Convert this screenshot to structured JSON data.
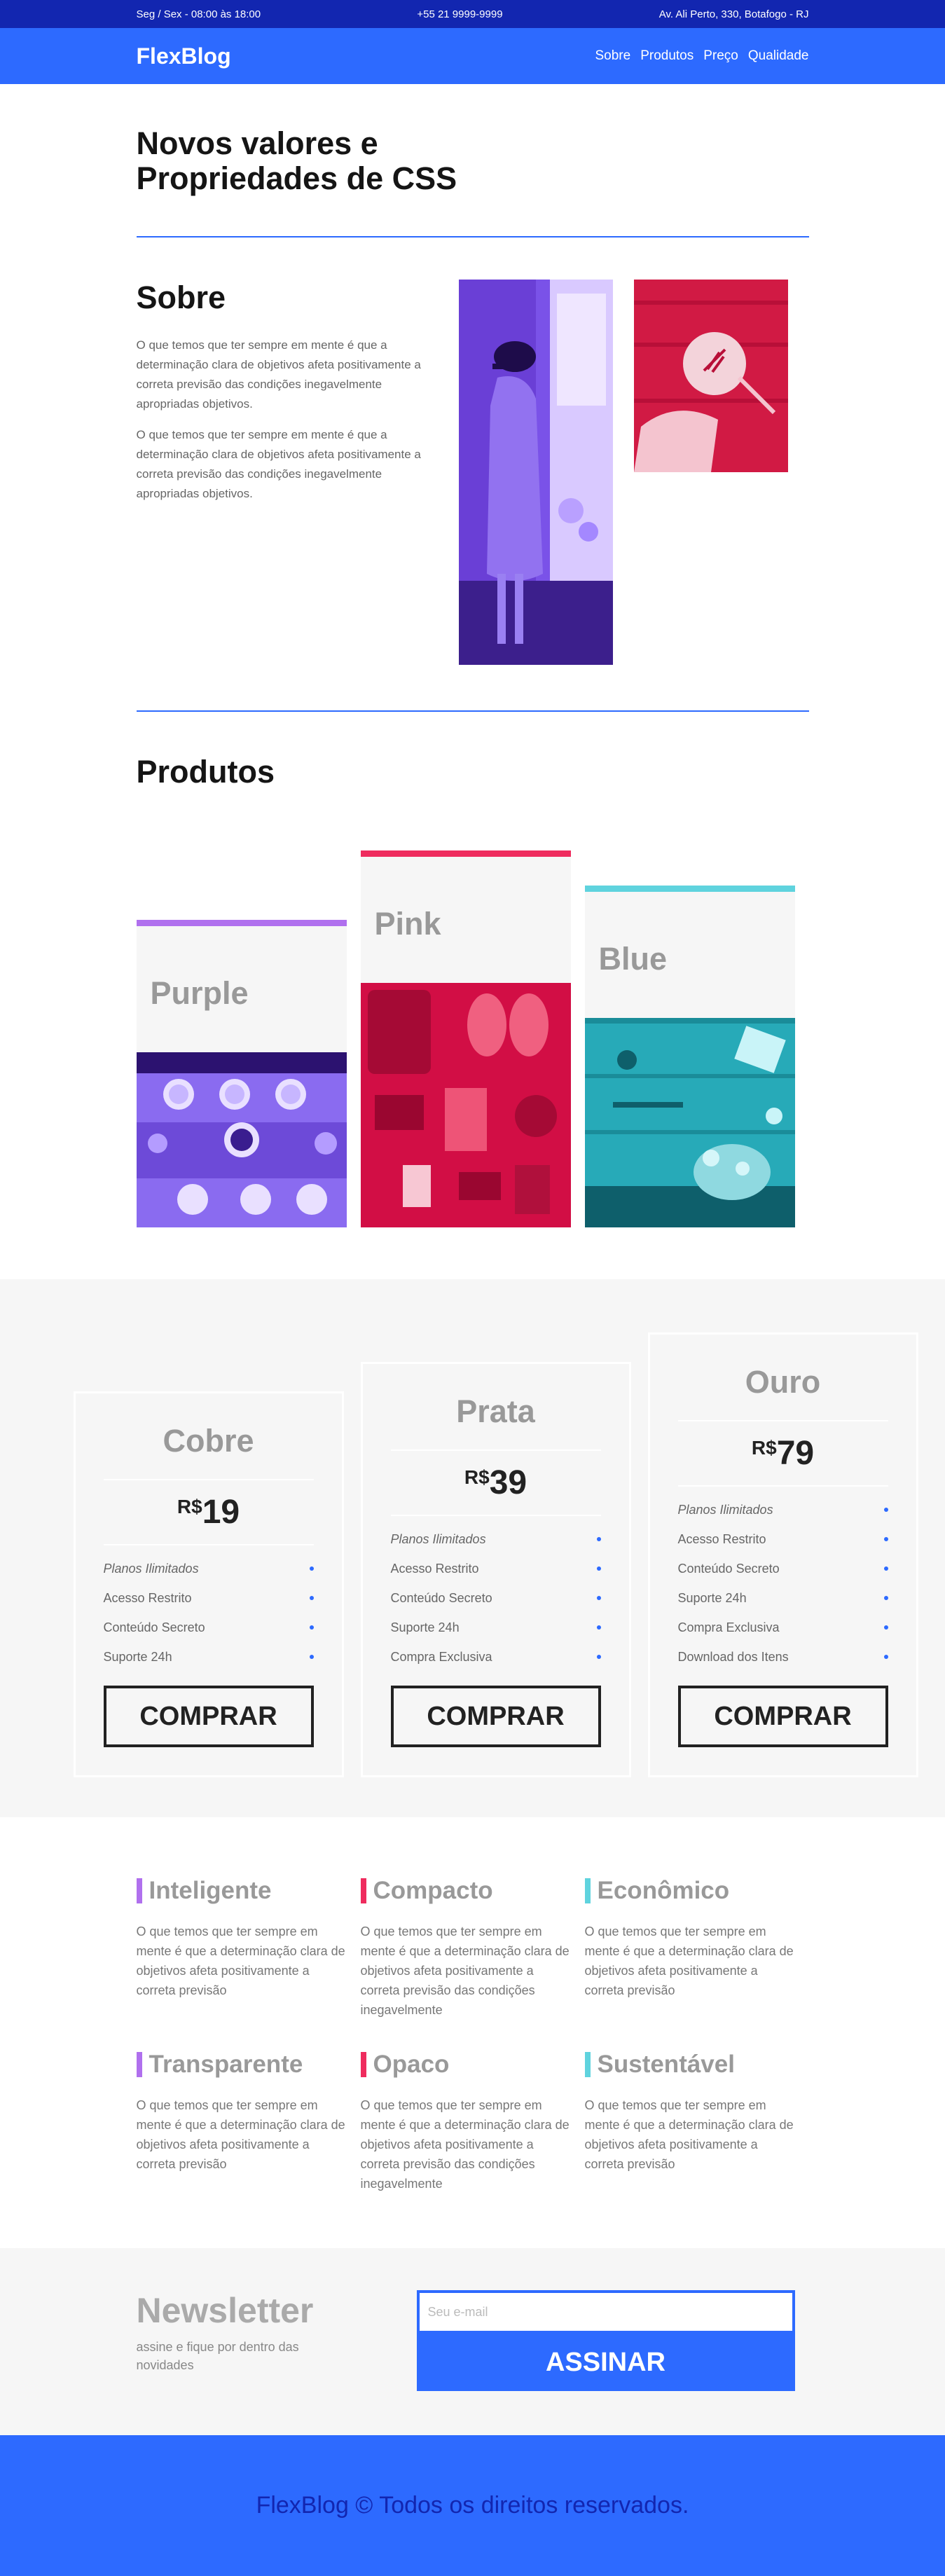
{
  "topbar": {
    "hours": "Seg / Sex - 08:00 às 18:00",
    "phone": "+55 21 9999-9999",
    "address": "Av. Ali Perto, 330, Botafogo - RJ"
  },
  "header": {
    "logo": "FlexBlog",
    "nav": [
      "Sobre",
      "Produtos",
      "Preço",
      "Qualidade"
    ]
  },
  "hero": {
    "title": "Novos valores e Propriedades de CSS"
  },
  "sobre": {
    "title": "Sobre",
    "paragraphs": [
      "O que temos que ter sempre em mente é que a determinação clara de objetivos afeta positivamente a correta previsão das condições inegavelmente apropriadas objetivos.",
      "O que temos que ter sempre em mente é que a determinação clara de objetivos afeta positivamente a correta previsão das condições inegavelmente apropriadas objetivos."
    ]
  },
  "produtos": {
    "title": "Produtos",
    "items": [
      {
        "name": "Purple",
        "color": "#b070ee"
      },
      {
        "name": "Pink",
        "color": "#ef2c5e"
      },
      {
        "name": "Blue",
        "color": "#5fd3de"
      }
    ]
  },
  "pricing": {
    "currency": "R$",
    "buy_label": "COMPRAR",
    "plans": [
      {
        "name": "Cobre",
        "price": "19",
        "features": [
          "Planos Ilimitados",
          "Acesso Restrito",
          "Conteúdo Secreto",
          "Suporte 24h"
        ]
      },
      {
        "name": "Prata",
        "price": "39",
        "features": [
          "Planos Ilimitados",
          "Acesso Restrito",
          "Conteúdo Secreto",
          "Suporte 24h",
          "Compra Exclusiva"
        ]
      },
      {
        "name": "Ouro",
        "price": "79",
        "features": [
          "Planos Ilimitados",
          "Acesso Restrito",
          "Conteúdo Secreto",
          "Suporte 24h",
          "Compra Exclusiva",
          "Download dos Itens"
        ]
      }
    ]
  },
  "features": [
    {
      "title": "Inteligente",
      "color": "#b070ee",
      "text": "O que temos que ter sempre em mente é que a determinação clara de objetivos afeta positivamente a correta previsão"
    },
    {
      "title": "Compacto",
      "color": "#ef2c5e",
      "text": "O que temos que ter sempre em mente é que a determinação clara de objetivos afeta positivamente a correta previsão das condições inegavelmente"
    },
    {
      "title": "Econômico",
      "color": "#5fd3de",
      "text": "O que temos que ter sempre em mente é que a determinação clara de objetivos afeta positivamente a correta previsão"
    },
    {
      "title": "Transparente",
      "color": "#b070ee",
      "text": "O que temos que ter sempre em mente é que a determinação clara de objetivos afeta positivamente a correta previsão"
    },
    {
      "title": "Opaco",
      "color": "#ef2c5e",
      "text": "O que temos que ter sempre em mente é que a determinação clara de objetivos afeta positivamente a correta previsão das condições inegavelmente"
    },
    {
      "title": "Sustentável",
      "color": "#5fd3de",
      "text": "O que temos que ter sempre em mente é que a determinação clara de objetivos afeta positivamente a correta previsão"
    }
  ],
  "newsletter": {
    "title": "Newsletter",
    "subtitle": "assine e fique por dentro das novidades",
    "placeholder": "Seu e-mail",
    "button": "ASSINAR"
  },
  "footer": {
    "text": "FlexBlog © Todos os direitos reservados."
  },
  "colors": {
    "primary": "#2d6aff",
    "dark_blue": "#1226b0",
    "light_bg": "#f6f6f6"
  }
}
